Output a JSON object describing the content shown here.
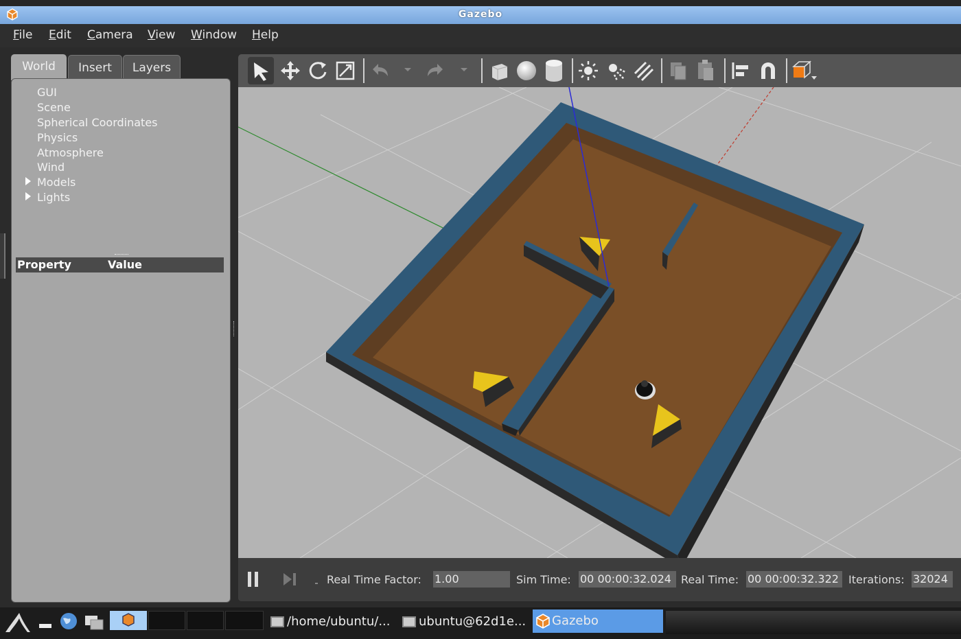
{
  "window": {
    "title": "Gazebo"
  },
  "menu": [
    {
      "label": "File",
      "u": "F",
      "rest": "ile"
    },
    {
      "label": "Edit",
      "u": "E",
      "rest": "dit"
    },
    {
      "label": "Camera",
      "u": "C",
      "rest": "amera"
    },
    {
      "label": "View",
      "u": "V",
      "rest": "iew"
    },
    {
      "label": "Window",
      "u": "W",
      "rest": "indow"
    },
    {
      "label": "Help",
      "u": "H",
      "rest": "elp"
    }
  ],
  "left_panel": {
    "tabs": [
      "World",
      "Insert",
      "Layers"
    ],
    "active_tab": "World",
    "tree": [
      "GUI",
      "Scene",
      "Spherical Coordinates",
      "Physics",
      "Atmosphere",
      "Wind",
      "Models",
      "Lights"
    ],
    "property_header": {
      "property": "Property",
      "value": "Value"
    }
  },
  "toolbar": {
    "icons": [
      "select-arrow-icon",
      "translate-icon",
      "rotate-icon",
      "scale-icon",
      "undo-icon",
      "redo-icon",
      "box-icon",
      "sphere-icon",
      "cylinder-icon",
      "point-light-icon",
      "spot-light-icon",
      "directional-light-icon",
      "copy-icon",
      "paste-icon",
      "align-icon",
      "snap-magnet-icon",
      "view-angle-icon"
    ]
  },
  "bottom_bar": {
    "rtf_label": "Real Time Factor:",
    "rtf_value": "1.00",
    "sim_label": "Sim Time:",
    "sim_value": "00 00:00:32.024",
    "real_label": "Real Time:",
    "real_value": "00 00:00:32.322",
    "iter_label": "Iterations:",
    "iter_value": "32024"
  },
  "taskbar": {
    "tasks": [
      "/home/ubuntu/...",
      "ubuntu@62d1e...",
      "Gazebo"
    ],
    "active_task": "Gazebo"
  },
  "colors": {
    "titlebar": "#8fb8ea",
    "panel": "#a6a6a6",
    "ground": "#b4b4b4",
    "floor": "#7a4f27",
    "wall_top": "#2e5878",
    "wall_side": "#2a2a2a",
    "cone": "#e8c41c",
    "active_task": "#5b9be6"
  }
}
